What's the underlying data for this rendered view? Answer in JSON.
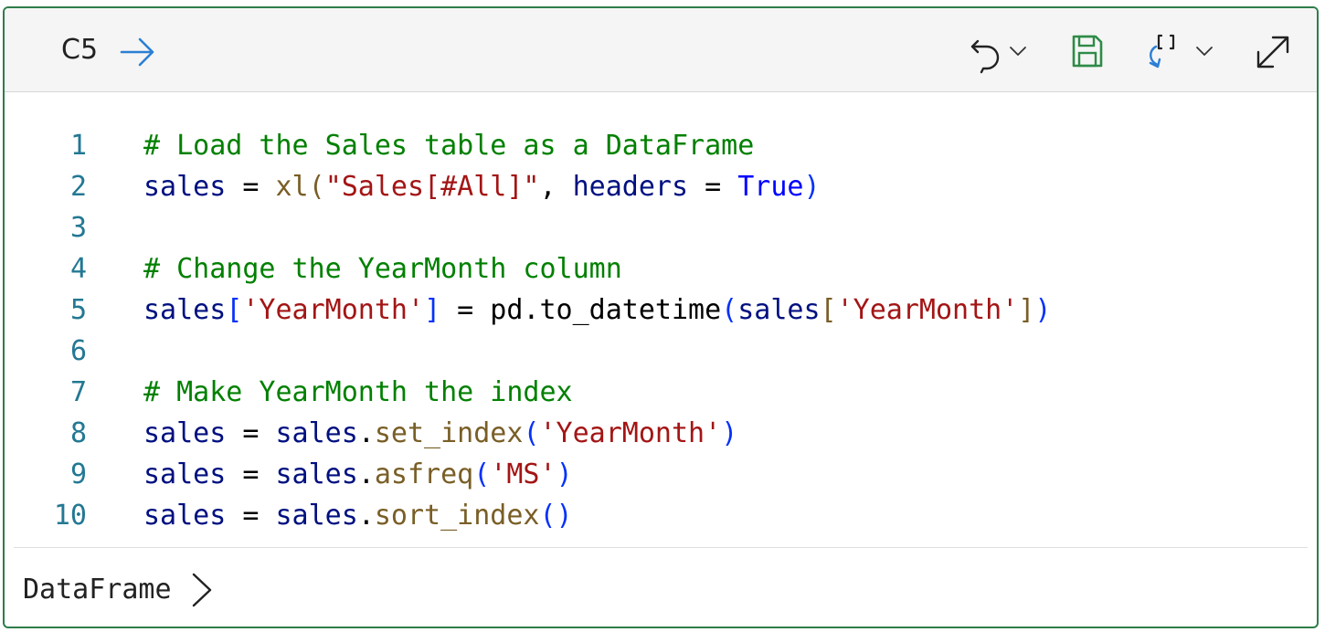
{
  "header": {
    "cell_ref": "C5",
    "icons": [
      "goto-arrow-icon",
      "undo-icon",
      "undo-dropdown-chevron-icon",
      "save-icon",
      "insert-output-icon",
      "output-dropdown-chevron-icon",
      "expand-icon"
    ]
  },
  "code": {
    "lines": [
      {
        "number": "1",
        "tokens": [
          {
            "t": "# Load the Sales table as a DataFrame",
            "k": "com"
          }
        ]
      },
      {
        "number": "2",
        "tokens": [
          {
            "t": "sales",
            "k": "var"
          },
          {
            "t": " = ",
            "k": "pl"
          },
          {
            "t": "xl",
            "k": "fn"
          },
          {
            "t": "(",
            "k": "fn"
          },
          {
            "t": "\"Sales[#All]\"",
            "k": "str"
          },
          {
            "t": ", ",
            "k": "pl"
          },
          {
            "t": "headers",
            "k": "var"
          },
          {
            "t": " = ",
            "k": "pl"
          },
          {
            "t": "True",
            "k": "kw"
          },
          {
            "t": ")",
            "k": "br"
          }
        ]
      },
      {
        "number": "3",
        "tokens": []
      },
      {
        "number": "4",
        "tokens": [
          {
            "t": "# Change the YearMonth column",
            "k": "com"
          }
        ]
      },
      {
        "number": "5",
        "tokens": [
          {
            "t": "sales",
            "k": "var"
          },
          {
            "t": "[",
            "k": "br"
          },
          {
            "t": "'YearMonth'",
            "k": "str"
          },
          {
            "t": "]",
            "k": "br"
          },
          {
            "t": " = pd.to_datetime",
            "k": "pl"
          },
          {
            "t": "(",
            "k": "br"
          },
          {
            "t": "sales",
            "k": "var"
          },
          {
            "t": "[",
            "k": "fn"
          },
          {
            "t": "'YearMonth'",
            "k": "str"
          },
          {
            "t": "]",
            "k": "fn"
          },
          {
            "t": ")",
            "k": "br"
          }
        ]
      },
      {
        "number": "6",
        "tokens": []
      },
      {
        "number": "7",
        "tokens": [
          {
            "t": "# Make YearMonth the index",
            "k": "com"
          }
        ]
      },
      {
        "number": "8",
        "tokens": [
          {
            "t": "sales",
            "k": "var"
          },
          {
            "t": " = ",
            "k": "pl"
          },
          {
            "t": "sales",
            "k": "var"
          },
          {
            "t": ".",
            "k": "pl"
          },
          {
            "t": "set_index",
            "k": "fn"
          },
          {
            "t": "(",
            "k": "br"
          },
          {
            "t": "'YearMonth'",
            "k": "str"
          },
          {
            "t": ")",
            "k": "br"
          }
        ]
      },
      {
        "number": "9",
        "tokens": [
          {
            "t": "sales",
            "k": "var"
          },
          {
            "t": " = ",
            "k": "pl"
          },
          {
            "t": "sales",
            "k": "var"
          },
          {
            "t": ".",
            "k": "pl"
          },
          {
            "t": "asfreq",
            "k": "fn"
          },
          {
            "t": "(",
            "k": "br"
          },
          {
            "t": "'MS'",
            "k": "str"
          },
          {
            "t": ")",
            "k": "br"
          }
        ]
      },
      {
        "number": "10",
        "tokens": [
          {
            "t": "sales",
            "k": "var"
          },
          {
            "t": " = ",
            "k": "pl"
          },
          {
            "t": "sales",
            "k": "var"
          },
          {
            "t": ".",
            "k": "pl"
          },
          {
            "t": "sort_index",
            "k": "fn"
          },
          {
            "t": "()",
            "k": "br"
          }
        ]
      }
    ]
  },
  "output": {
    "type_label": "DataFrame"
  },
  "colors": {
    "border": "#2e7d4a",
    "save_icon": "#2e8b47",
    "link_icon": "#2b7fd4",
    "line_number": "#237893"
  }
}
